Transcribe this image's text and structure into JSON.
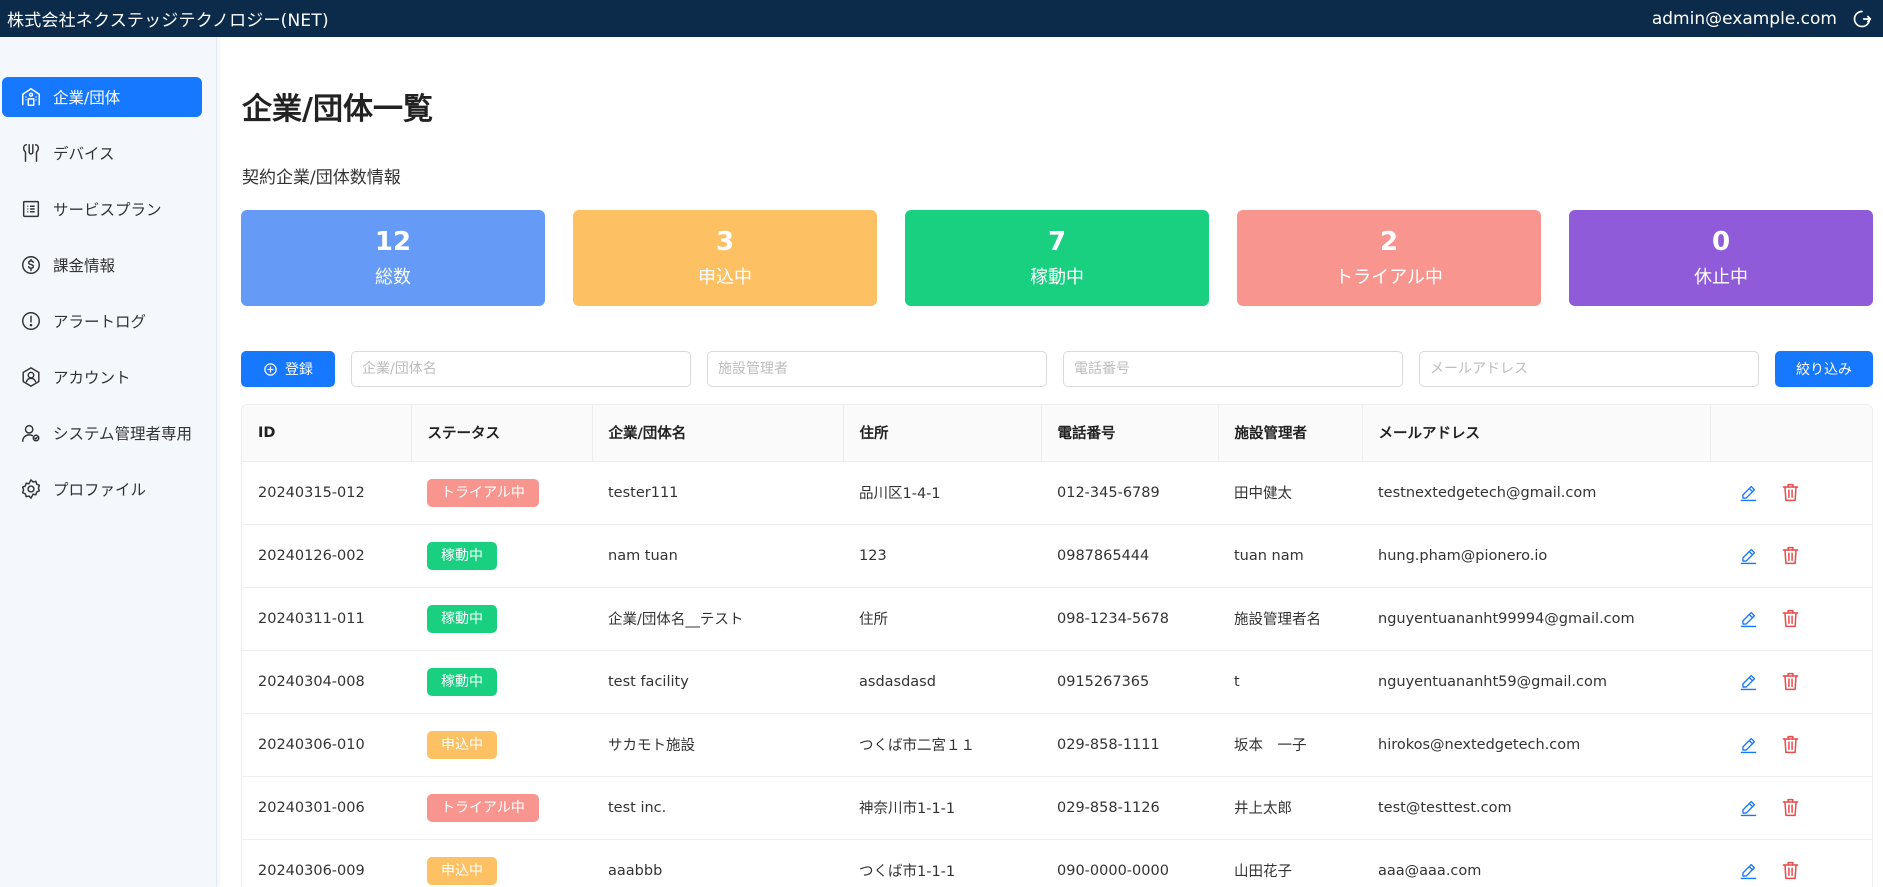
{
  "header": {
    "brand": "株式会社ネクステッジテクノロジー(NET)",
    "user_email": "admin@example.com",
    "logout_icon": "logout-icon"
  },
  "sidebar": {
    "items": [
      {
        "label": "企業/団体",
        "icon": "building-icon",
        "active": true
      },
      {
        "label": "デバイス",
        "icon": "device-icon",
        "active": false
      },
      {
        "label": "サービスプラン",
        "icon": "list-icon",
        "active": false
      },
      {
        "label": "課金情報",
        "icon": "dollar-icon",
        "active": false
      },
      {
        "label": "アラートログ",
        "icon": "alert-icon",
        "active": false
      },
      {
        "label": "アカウント",
        "icon": "account-icon",
        "active": false
      },
      {
        "label": "システム管理者専用",
        "icon": "admin-user-icon",
        "active": false
      },
      {
        "label": "プロファイル",
        "icon": "gear-icon",
        "active": false
      }
    ]
  },
  "main": {
    "title": "企業/団体一覧",
    "stats_title": "契約企業/団体数情報",
    "stats": [
      {
        "value": "12",
        "label": "総数",
        "color": "#659bf7"
      },
      {
        "value": "3",
        "label": "申込中",
        "color": "#fdc062"
      },
      {
        "value": "7",
        "label": "稼動中",
        "color": "#19cf80"
      },
      {
        "value": "2",
        "label": "トライアル中",
        "color": "#f9958f"
      },
      {
        "value": "0",
        "label": "休止中",
        "color": "#8f5bd8"
      }
    ],
    "filters": {
      "register_label": "登録",
      "name_placeholder": "企業/団体名",
      "manager_placeholder": "施設管理者",
      "phone_placeholder": "電話番号",
      "email_placeholder": "メールアドレス",
      "filter_label": "絞り込み"
    },
    "table": {
      "columns": [
        "ID",
        "ステータス",
        "企業/団体名",
        "住所",
        "電話番号",
        "施設管理者",
        "メールアドレス",
        ""
      ],
      "status_colors": {
        "トライアル中": "#f9958f",
        "稼動中": "#19cf80",
        "申込中": "#fdc062"
      },
      "rows": [
        {
          "id": "20240315-012",
          "status": "トライアル中",
          "name": "tester111",
          "address": "品川区1-4-1",
          "phone": "012-345-6789",
          "manager": "田中健太",
          "email": "testnextedgetech@gmail.com"
        },
        {
          "id": "20240126-002",
          "status": "稼動中",
          "name": "nam tuan",
          "address": "123",
          "phone": "0987865444",
          "manager": "tuan nam",
          "email": "hung.pham@pionero.io"
        },
        {
          "id": "20240311-011",
          "status": "稼動中",
          "name": "企業/団体名__テスト",
          "address": "住所",
          "phone": "098-1234-5678",
          "manager": "施設管理者名",
          "email": "nguyentuananht99994@gmail.com"
        },
        {
          "id": "20240304-008",
          "status": "稼動中",
          "name": "test facility",
          "address": "asdasdasd",
          "phone": "0915267365",
          "manager": "t",
          "email": "nguyentuananht59@gmail.com"
        },
        {
          "id": "20240306-010",
          "status": "申込中",
          "name": "サカモト施設",
          "address": "つくば市二宮１１",
          "phone": "029-858-1111",
          "manager": "坂本　一子",
          "email": "hirokos@nextedgetech.com"
        },
        {
          "id": "20240301-006",
          "status": "トライアル中",
          "name": "test inc.",
          "address": "神奈川市1-1-1",
          "phone": "029-858-1126",
          "manager": "井上太郎",
          "email": "test@testtest.com"
        },
        {
          "id": "20240306-009",
          "status": "申込中",
          "name": "aaabbb",
          "address": "つくば市1-1-1",
          "phone": "090-0000-0000",
          "manager": "山田花子",
          "email": "aaa@aaa.com"
        }
      ]
    }
  }
}
